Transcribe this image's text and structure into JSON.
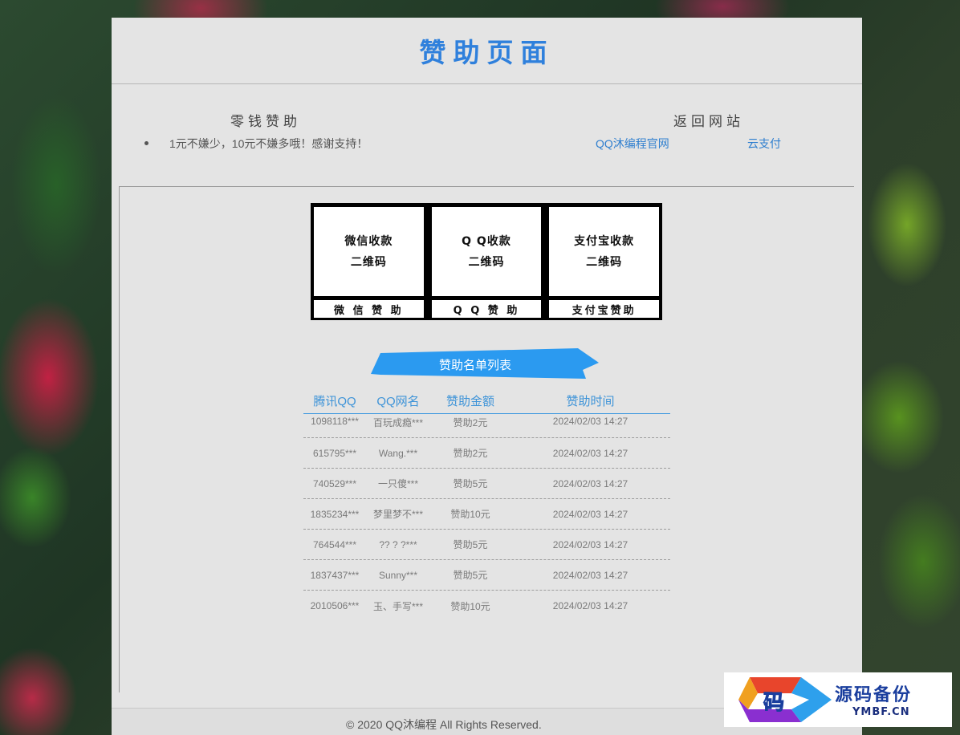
{
  "header": {
    "title": "赞助页面"
  },
  "info": {
    "left_title": "零钱赞助",
    "note": "1元不嫌少，10元不嫌多哦！感谢支持！",
    "right_title": "返回网站",
    "links": [
      "QQ沐编程官网",
      "云支付"
    ]
  },
  "qr_cards": [
    {
      "line1": "微信收款",
      "line2": "二维码",
      "label": "微 信 赞 助"
    },
    {
      "line1": "Q Q收款",
      "line2": "二维码",
      "label": "Q Q 赞 助"
    },
    {
      "line1": "支付宝收款",
      "line2": "二维码",
      "label": "支付宝赞助"
    }
  ],
  "ribbon": {
    "label": "赞助名单列表",
    "color": "#2b9af0"
  },
  "table": {
    "headers": [
      "腾讯QQ",
      "QQ网名",
      "赞助金额",
      "赞助时间"
    ],
    "rows": [
      [
        "1098118***",
        "百玩成瘾***",
        "赞助2元",
        "2024/02/03 14:27"
      ],
      [
        "615795***",
        "Wang.***",
        "赞助2元",
        "2024/02/03 14:27"
      ],
      [
        "740529***",
        "一只傻***",
        "赞助5元",
        "2024/02/03 14:27"
      ],
      [
        "1835234***",
        "梦里梦不***",
        "赞助10元",
        "2024/02/03 14:27"
      ],
      [
        "764544***",
        "?? ? ?***",
        "赞助5元",
        "2024/02/03 14:27"
      ],
      [
        "1837437***",
        "Sunny***",
        "赞助5元",
        "2024/02/03 14:27"
      ],
      [
        "2010506***",
        "玉、手写***",
        "赞助10元",
        "2024/02/03 14:27"
      ]
    ]
  },
  "footer": {
    "copyright": "© 2020 QQ沐编程 All Rights Reserved."
  },
  "watermark": {
    "logo_char": "码",
    "title": "源码备份",
    "sub": "YMBF.CN"
  },
  "colors": {
    "accent": "#2f80dc",
    "link": "#2f7fcf",
    "table_header": "#3d93d8"
  }
}
